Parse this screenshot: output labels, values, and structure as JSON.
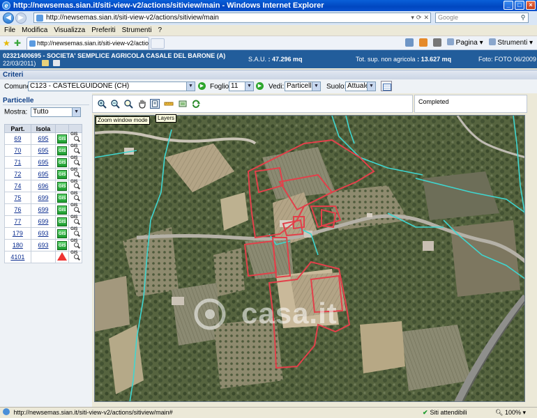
{
  "window": {
    "title": "http://newsemas.sian.it/siti-view-v2/actions/sitiview/main - Windows Internet Explorer",
    "address": "http://newsemas.sian.it/siti-view-v2/actions/sitiview/main",
    "search_placeholder": "Google",
    "tab_label": "http://newsemas.sian.it/siti-view-v2/actions/sitiview/...",
    "menu": [
      "File",
      "Modifica",
      "Visualizza",
      "Preferiti",
      "Strumenti",
      "?"
    ],
    "cmd_pagina": "Pagina",
    "cmd_strumenti": "Strumenti"
  },
  "header": {
    "company": "02321400695 - SOCIETA' SEMPLICE AGRICOLA CASALE DEL BARONE (A)",
    "date": "22/03/2011)",
    "sau_label": "S.A.U.",
    "sau_value": ": 47.296  mq",
    "tsup_label": "Tot. sup. non agricola",
    "tsup_value": ": 13.627  mq",
    "foto": "Foto: FOTO 06/2009"
  },
  "criteri": {
    "title": "Criteri",
    "comune_label": "Comune:",
    "comune_value": "C123 - CASTELGUIDONE (CH)",
    "foglio_label": "Foglio:",
    "foglio_value": "11",
    "vedi_label": "Vedi:",
    "vedi_value": "Particelle",
    "suolo_label": "Suolo:",
    "suolo_value": "Attuale"
  },
  "particelle": {
    "title": "Particelle",
    "mostra_label": "Mostra:",
    "mostra_value": "Tutto",
    "col_part": "Part.",
    "col_isola": "Isola",
    "gis_label": "GIS",
    "rows": [
      {
        "part": "69",
        "isola": "695",
        "status": "gis"
      },
      {
        "part": "70",
        "isola": "695",
        "status": "gis"
      },
      {
        "part": "71",
        "isola": "695",
        "status": "gis"
      },
      {
        "part": "72",
        "isola": "695",
        "status": "gis"
      },
      {
        "part": "74",
        "isola": "696",
        "status": "gis"
      },
      {
        "part": "75",
        "isola": "699",
        "status": "gis"
      },
      {
        "part": "76",
        "isola": "699",
        "status": "gis"
      },
      {
        "part": "77",
        "isola": "699",
        "status": "gis"
      },
      {
        "part": "179",
        "isola": "693",
        "status": "gis"
      },
      {
        "part": "180",
        "isola": "693",
        "status": "gis"
      },
      {
        "part": "4101",
        "isola": "",
        "status": "warning"
      }
    ]
  },
  "map": {
    "tooltip_zoom": "Zoom window mode",
    "tooltip_layers": "Layers",
    "status": "Completed",
    "watermark": "casa.it"
  },
  "statusbar": {
    "url": "http://newsemas.sian.it/siti-view-v2/actions/sitiview/main#",
    "trusted": "Siti attendibili",
    "zoom": "100%"
  },
  "colors": {
    "header_bg": "#225d9b",
    "parcel_outline": "#e2404a",
    "cadastral_line": "#3fd6d0"
  }
}
